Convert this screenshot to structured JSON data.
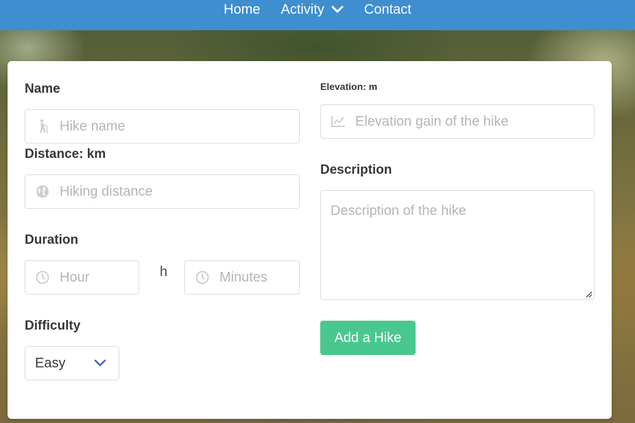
{
  "nav": {
    "items": [
      {
        "label": "Home"
      },
      {
        "label": "Activity"
      },
      {
        "label": "Contact"
      }
    ]
  },
  "form": {
    "name": {
      "label": "Name",
      "placeholder": "Hike name",
      "icon": "hiker-icon"
    },
    "distance": {
      "label": "Distance: km",
      "placeholder": "Hiking distance",
      "icon": "globe-icon"
    },
    "duration": {
      "label": "Duration",
      "hour_placeholder": "Hour",
      "unit": "h",
      "minutes_placeholder": "Minutes",
      "icon": "clock-icon"
    },
    "difficulty": {
      "label": "Difficulty",
      "selected": "Easy"
    },
    "elevation": {
      "label": "Elevation: m",
      "placeholder": "Elevation gain of the hike",
      "icon": "chart-line-icon"
    },
    "description": {
      "label": "Description",
      "placeholder": "Description of the hike"
    },
    "submit_label": "Add a Hike"
  },
  "colors": {
    "navbar": "#3e8ed0",
    "button": "#48c78e",
    "chevron": "#485fc7"
  }
}
